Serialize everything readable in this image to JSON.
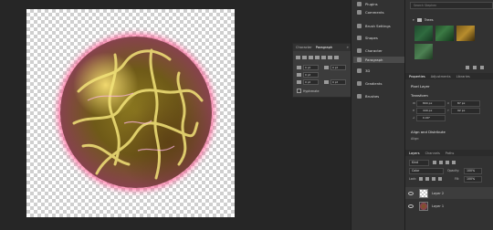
{
  "float_panel": {
    "tabs": [
      "Character",
      "Paragraph"
    ],
    "active_tab": "Paragraph",
    "close": "»",
    "fields": [
      "0 pt",
      "0 pt",
      "0 pt",
      "0 pt",
      "0 pt"
    ],
    "hyphenate_label": "Hyphenate"
  },
  "mid_col": {
    "items": [
      {
        "label": "Plugins",
        "icon": "plugin-icon"
      },
      {
        "label": "Comments",
        "icon": "comment-icon"
      },
      {
        "label": "Brush Settings",
        "icon": "brush-icon"
      },
      {
        "label": "Shapes",
        "icon": "shape-icon"
      },
      {
        "label": "Character",
        "icon": "character-icon"
      },
      {
        "label": "Paragraph",
        "icon": "paragraph-icon"
      },
      {
        "label": "3D",
        "icon": "3d-icon"
      },
      {
        "label": "Gradients",
        "icon": "gradient-icon"
      },
      {
        "label": "Brushes",
        "icon": "brushes-icon"
      }
    ]
  },
  "libraries": {
    "search_placeholder": "Search Stephen",
    "folder_label": "Trees"
  },
  "properties": {
    "tabs": [
      "Properties",
      "Adjustments",
      "Libraries"
    ],
    "layer_type": "Pixel Layer",
    "transform_label": "Transform",
    "w": "800 px",
    "x": "87 px",
    "h": "449 px",
    "y": "92 px",
    "angle": "0.00°",
    "align_label": "Align and Distribute",
    "align_sub": "Align:"
  },
  "layers": {
    "tabs": [
      "Layers",
      "Channels",
      "Paths"
    ],
    "kind_label": "Kind",
    "blend_mode": "Color",
    "opacity_label": "Opacity:",
    "opacity": "100%",
    "lock_label": "Lock:",
    "fill_label": "Fill:",
    "fill": "100%",
    "rows": [
      {
        "name": "Layer 2",
        "selected": true
      },
      {
        "name": "Layer 1",
        "selected": false
      }
    ]
  }
}
